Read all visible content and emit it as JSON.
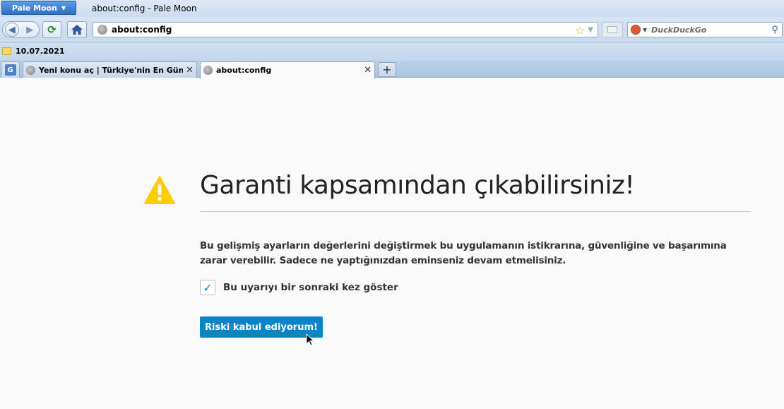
{
  "titlebar": {
    "app_menu_label": "Pale Moon",
    "window_title": "about:config - Pale Moon"
  },
  "navbar": {
    "url": "about:config",
    "search_placeholder": "DuckDuckGo",
    "icons": [
      "back-icon",
      "forward-icon",
      "reload-icon",
      "home-icon",
      "globe-icon",
      "star-icon",
      "reader-icon",
      "duckduckgo-icon",
      "magnifier-icon"
    ]
  },
  "bookmarks": {
    "items": [
      {
        "label": "10.07.2021"
      }
    ]
  },
  "tabs": {
    "items": [
      {
        "label": "Yeni konu aç | Türkiye'nin En Günc..."
      },
      {
        "label": "about:config"
      }
    ]
  },
  "warning": {
    "heading": "Garanti kapsamından çıkabilirsiniz!",
    "description": "Bu gelişmiş ayarların değerlerini değiştirmek bu uygulamanın istikrarına, güvenliğine ve başarımına zarar verebilir. Sadece ne yaptığınızdan eminseniz devam etmelisiniz.",
    "checkbox_label": "Bu uyarıyı bir sonraki kez göster",
    "checkbox_checked": true,
    "accept_button": "Riski kabul ediyorum!"
  },
  "colors": {
    "accent": "#0a84c9",
    "warning": "#ffc107"
  }
}
